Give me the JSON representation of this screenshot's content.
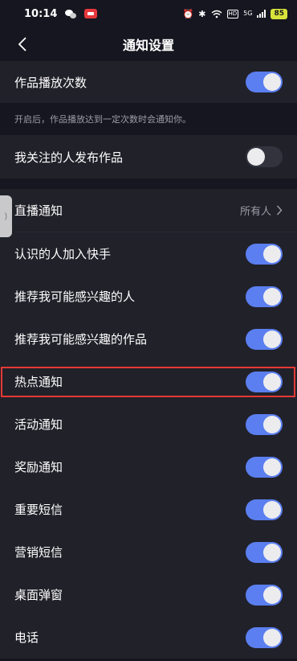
{
  "status_bar": {
    "time": "10:14",
    "hd_label": "HD",
    "network_label": "5G",
    "battery": "85"
  },
  "header": {
    "title": "通知设置"
  },
  "rows": {
    "play_count": {
      "label": "作品播放次数",
      "on": true
    },
    "play_count_desc": "开启后，作品播放达到一定次数时会通知你。",
    "followed_publish": {
      "label": "我关注的人发布作品",
      "on": false
    },
    "live": {
      "label": "直播通知",
      "value": "所有人"
    },
    "acquaintance": {
      "label": "认识的人加入快手",
      "on": true
    },
    "recommend_people": {
      "label": "推荐我可能感兴趣的人",
      "on": true
    },
    "recommend_works": {
      "label": "推荐我可能感兴趣的作品",
      "on": true
    },
    "hot": {
      "label": "热点通知",
      "on": true
    },
    "activity": {
      "label": "活动通知",
      "on": true
    },
    "reward": {
      "label": "奖励通知",
      "on": true
    },
    "important_sms": {
      "label": "重要短信",
      "on": true
    },
    "marketing_sms": {
      "label": "营销短信",
      "on": true
    },
    "desktop_popup": {
      "label": "桌面弹窗",
      "on": true
    },
    "phone": {
      "label": "电话",
      "on": true
    }
  },
  "colors": {
    "background": "#161620",
    "row_background": "#21212a",
    "toggle_on": "#5b7ff0",
    "toggle_off": "#33333d",
    "highlight": "#e53935"
  },
  "icons": {
    "back": "chevron-left-icon",
    "live_arrow": "chevron-right-icon",
    "side_tab": "double-chevron-icon"
  }
}
